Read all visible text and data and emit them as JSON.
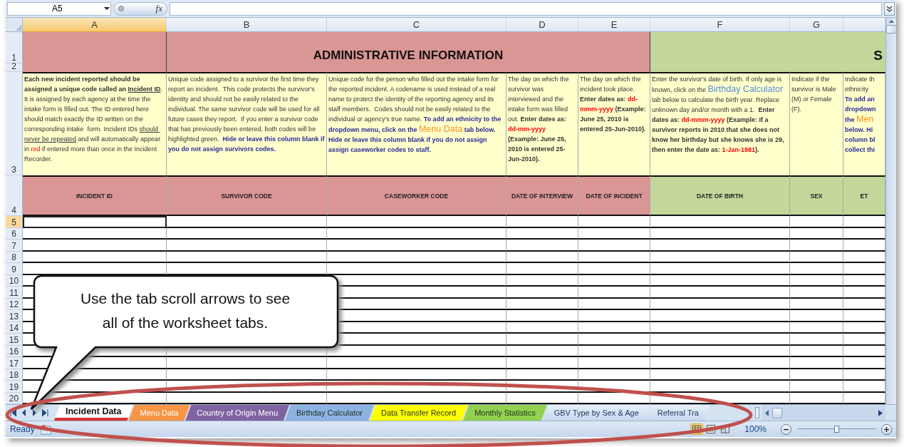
{
  "name_box": {
    "value": "A5"
  },
  "formula_bar": {
    "fx_label": "fx"
  },
  "columns": [
    {
      "label": "A",
      "selected": true
    },
    {
      "label": "B",
      "selected": false
    },
    {
      "label": "C",
      "selected": false
    },
    {
      "label": "D",
      "selected": false
    },
    {
      "label": "E",
      "selected": false
    },
    {
      "label": "F",
      "selected": false
    },
    {
      "label": "G",
      "selected": false
    },
    {
      "selected": false
    }
  ],
  "rows": [
    {
      "label": "1",
      "selected": false
    },
    {
      "label": "2",
      "selected": false
    },
    {
      "label": "3",
      "selected": false
    },
    {
      "label": "4",
      "selected": false
    },
    {
      "label": "5",
      "selected": true
    },
    {
      "label": "6",
      "selected": false
    },
    {
      "label": "7",
      "selected": false
    },
    {
      "label": "8",
      "selected": false
    },
    {
      "label": "9",
      "selected": false
    },
    {
      "label": "10",
      "selected": false
    },
    {
      "label": "11",
      "selected": false
    },
    {
      "label": "12",
      "selected": false
    },
    {
      "label": "13",
      "selected": false
    },
    {
      "label": "14",
      "selected": false
    },
    {
      "label": "15",
      "selected": false
    },
    {
      "label": "16",
      "selected": false
    },
    {
      "label": "17",
      "selected": false
    },
    {
      "label": "18",
      "selected": false
    },
    {
      "label": "19",
      "selected": false
    },
    {
      "label": "20",
      "selected": false
    }
  ],
  "bands": [
    {
      "color": "#da9694"
    },
    {
      "title": "ADMINISTRATIVE INFORMATION",
      "color": "#da9694"
    },
    {
      "title": "S",
      "color": "#c4d79b"
    }
  ],
  "fields": [
    {
      "header": "INCIDENT ID",
      "color": "#da9694",
      "description": [
        {
          "kind": "bold",
          "text": "Each new incident reported should be assigned a unique code called an "
        },
        {
          "kind": "bold-underline",
          "text": "Incident ID"
        },
        {
          "kind": "plain",
          "text": ". It is assigned by each agency at the time the intake form is filled out. The ID entered here should match exactly the ID written on the corresponding intake  form. Incident IDs "
        },
        {
          "kind": "underline",
          "text": "should never be repeated"
        },
        {
          "kind": "plain",
          "text": " and will automatically appear in "
        },
        {
          "kind": "red",
          "text": "red"
        },
        {
          "kind": "plain",
          "text": " if entered more than once in the Incident Recorder."
        }
      ]
    },
    {
      "header": "SURVIVOR CODE",
      "color": "#da9694",
      "description": [
        {
          "kind": "plain",
          "text": "Unique code assigned to a survivor the first time they report an incident.  This code protects the survivor's identity and should not be easily related to the individual. The same survivor code will be used for all future cases they report.  If you enter a survivor code that has previously been entered, both codes will be highlighted green.  "
        },
        {
          "kind": "blue",
          "text": "Hide or leave this column blank if you do not assign survivors codes."
        }
      ]
    },
    {
      "header": "CASEWORKER CODE",
      "color": "#da9694",
      "description": [
        {
          "kind": "plain",
          "text": "Unique code for the person who filled out the intake form for the reported incident. A codename is used instead of a real name to protect the identity of the reporting agency and its staff members.  Codes should not be easily related to the individual or agency's true name. "
        },
        {
          "kind": "blue",
          "text": "To add an ethnicity to the dropdown menu, click on the "
        },
        {
          "kind": "big-orange",
          "text": "Menu Data"
        },
        {
          "kind": "blue",
          "text": " tab below. Hide or leave this column blank if you do not assign assign caseworker codes to staff."
        }
      ]
    },
    {
      "header": "DATE OF INTERVIEW",
      "color": "#da9694",
      "description": [
        {
          "kind": "plain",
          "text": "The day on which the survivor was interviewed and the intake form was filled out. "
        },
        {
          "kind": "bold",
          "text": "Enter dates as: "
        },
        {
          "kind": "bold-red",
          "text": "dd-mm-yyyy"
        },
        {
          "kind": "bold",
          "text": " (Example: June 25, 2010 is entered 25-Jun-2010)."
        }
      ]
    },
    {
      "header": "DATE OF INCIDENT",
      "color": "#da9694",
      "description": [
        {
          "kind": "plain",
          "text": "The day on which the incident took place. "
        },
        {
          "kind": "bold",
          "text": "Enter dates as: "
        },
        {
          "kind": "bold-red",
          "text": "dd-mmm-yyyy"
        },
        {
          "kind": "bold",
          "text": " (Example: June 25, 2010 is entered 25-Jun-2010)."
        }
      ]
    },
    {
      "header": "DATE OF BIRTH",
      "color": "#c4d79b",
      "description": [
        {
          "kind": "plain",
          "text": "Enter the survivor's date of birth. If only age is known, click on the "
        },
        {
          "kind": "big-blue",
          "text": "Birthday Calculator"
        },
        {
          "kind": "plain",
          "text": " tab below to calculate the birth year. Replace unknown day and/or month with a 1.  "
        },
        {
          "kind": "bold",
          "text": "Enter dates as: "
        },
        {
          "kind": "bold-red",
          "text": "dd-mmm-yyyy"
        },
        {
          "kind": "bold",
          "text": " (Example: If a survivor reports in 2010 that she does not know her birthday but she knows she is 29, then enter the date as: "
        },
        {
          "kind": "bold-red",
          "text": "1-Jan-1981"
        },
        {
          "kind": "bold",
          "text": ")."
        }
      ]
    },
    {
      "header": "SEX",
      "color": "#c4d79b",
      "description": [
        {
          "kind": "plain",
          "text": "Indicate if the survivor is Male (M) or Female (F)."
        }
      ]
    },
    {
      "header": "ET",
      "color": "#c4d79b",
      "description": [
        {
          "kind": "plain",
          "text": "Indicate th\nethnicity\n"
        },
        {
          "kind": "blue",
          "text": "To add an\ndropdown\nthe "
        },
        {
          "kind": "big-orange",
          "text": "Men"
        },
        {
          "kind": "blue",
          "text": "\nbelow. Hi\ncolumn bl\ncollect thi"
        }
      ]
    }
  ],
  "sheet_tabs": [
    {
      "label": "Incident Data",
      "selected": true,
      "color": "#e03030"
    },
    {
      "label": "Menu Data",
      "selected": false,
      "color": "#f79646"
    },
    {
      "label": "Country of Origin Menu",
      "selected": false,
      "color": "#8064a2"
    },
    {
      "label": "Birthday Calculator",
      "selected": false,
      "color": "#8db3e2"
    },
    {
      "label": "Data Transfer Record",
      "selected": false,
      "color": "#ffff00"
    },
    {
      "label": "Monthly Statistics",
      "selected": false,
      "color": "#92d050"
    },
    {
      "label": "GBV Type by Sex & Age",
      "selected": false
    },
    {
      "label": "Referral Tra",
      "selected": false
    }
  ],
  "status_bar": {
    "status": "Ready",
    "view_buttons": [
      {
        "kind": "normal",
        "selected": true
      },
      {
        "kind": "page-layout",
        "selected": false
      },
      {
        "kind": "page-break",
        "selected": false
      }
    ],
    "zoom": "100%",
    "zoom_slider": {
      "level": 0.5
    }
  },
  "callout": {
    "text": "Use the tab scroll arrows to see all of the worksheet tabs."
  }
}
